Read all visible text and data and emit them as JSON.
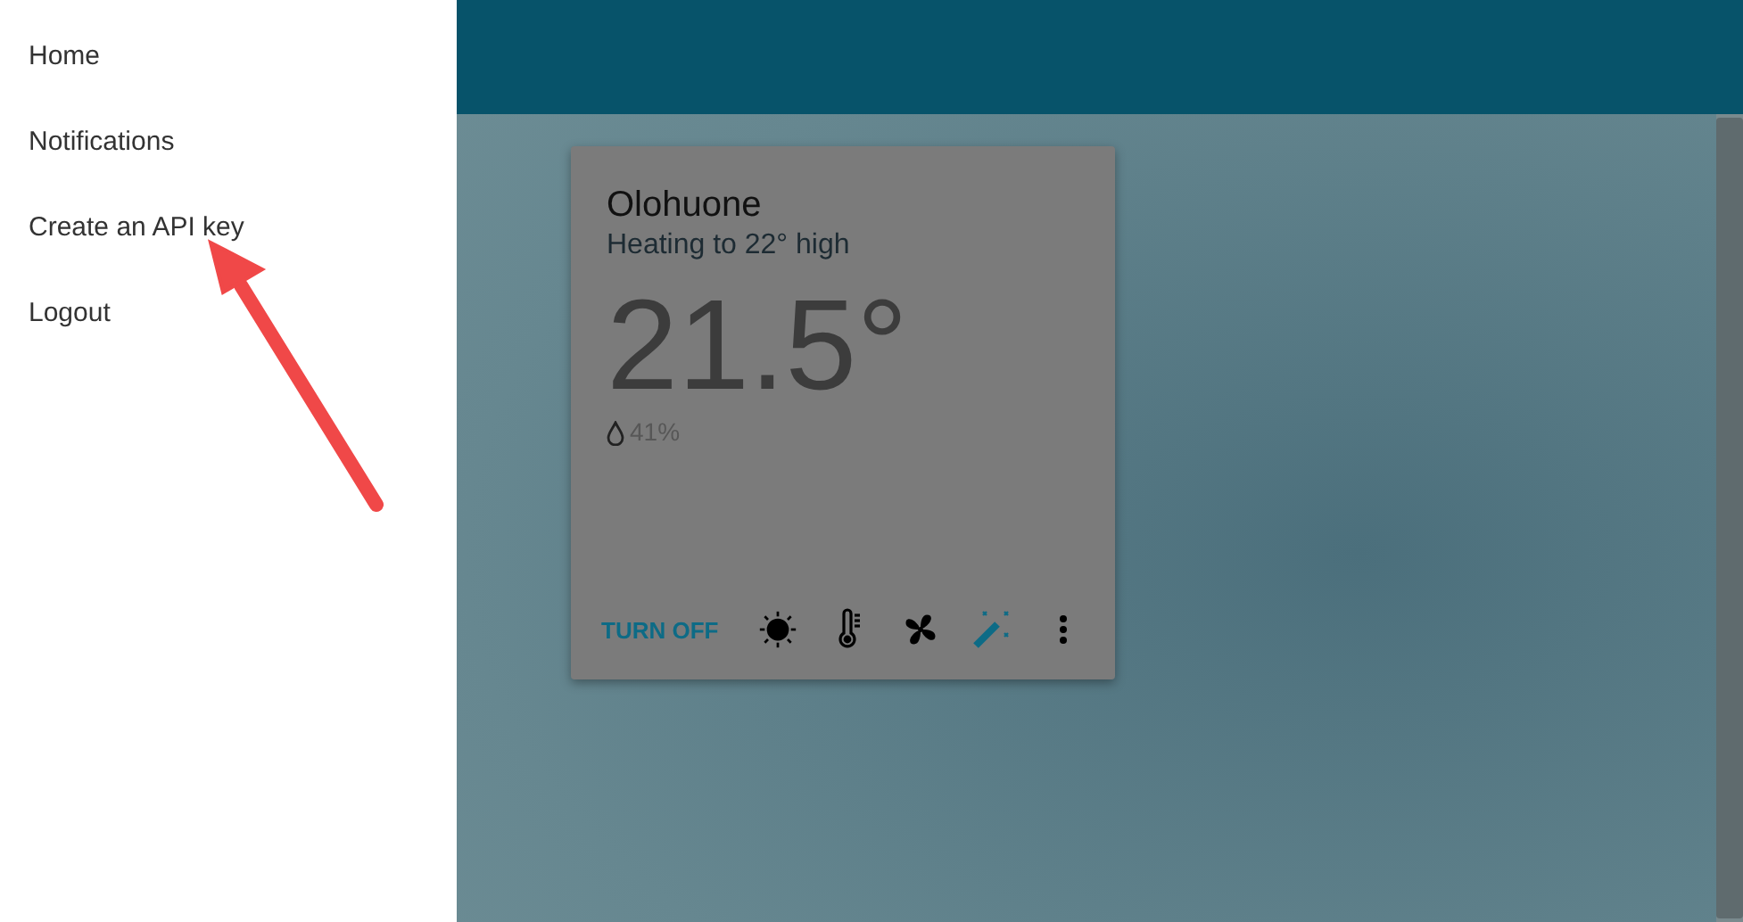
{
  "drawer": {
    "items": [
      {
        "label": "Home"
      },
      {
        "label": "Notifications"
      },
      {
        "label": "Create an API key"
      },
      {
        "label": "Logout"
      }
    ]
  },
  "thermostat": {
    "name": "Olohuone",
    "status": "Heating to 22° high",
    "temperature": "21.5°",
    "humidity": "41%",
    "action": "TURN OFF",
    "modes": [
      {
        "kind": "heat",
        "selected": false
      },
      {
        "kind": "temperature",
        "selected": false
      },
      {
        "kind": "fan",
        "selected": false
      },
      {
        "kind": "auto",
        "selected": true
      }
    ]
  }
}
